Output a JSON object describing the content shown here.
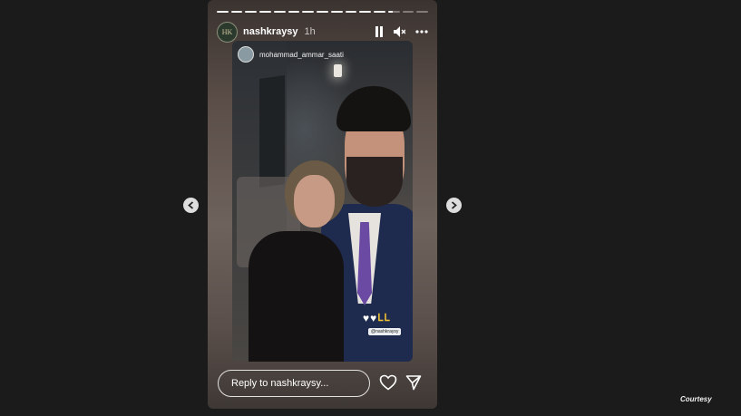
{
  "story": {
    "progress_segments": 15,
    "progress_complete": 13,
    "header": {
      "avatar_initials": "HK",
      "username": "nashkraysy",
      "time": "1h",
      "icons": [
        "pause-icon",
        "mute-icon",
        "more-icon"
      ]
    },
    "media": {
      "repost_username": "mohammad_ammar_saati",
      "sticker_mention": "@nashkraysy"
    },
    "reply": {
      "placeholder": "Reply to nashkraysy..."
    },
    "actions": [
      "heart-icon",
      "send-icon"
    ]
  },
  "navigation": {
    "prev_icon": "chevron-left-icon",
    "next_icon": "chevron-right-icon"
  },
  "watermark": "Courtesy",
  "colors": {
    "background": "#1b1b1b",
    "story_frame": "#5b4e48",
    "text": "#ffffff",
    "tie": "#6a4aa3"
  }
}
